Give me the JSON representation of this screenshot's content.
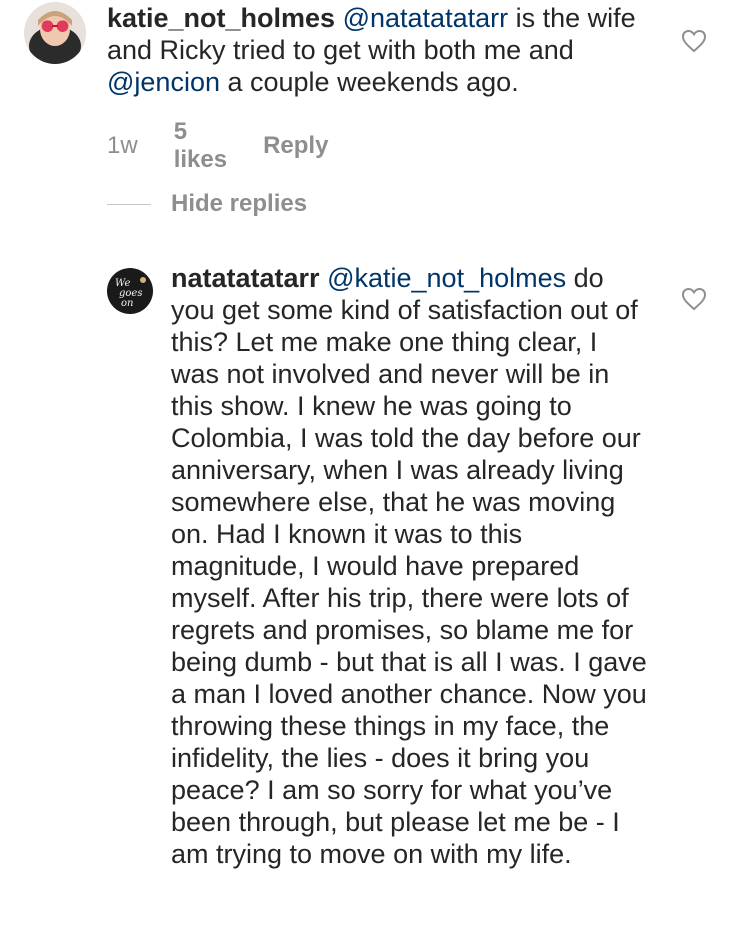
{
  "comment1": {
    "username": "katie_not_holmes",
    "mention1": "@natatatatarr",
    "text_a": " is the wife and Ricky tried to get with both me and ",
    "mention2": "@jencion",
    "text_b": " a couple weekends ago.",
    "time": "1w",
    "likes": "5 likes",
    "reply": "Reply"
  },
  "replies": {
    "hide_label": "Hide replies"
  },
  "comment2": {
    "username": "natatatatarr",
    "mention": "@katie_not_holmes",
    "text": " do you get some kind of satisfaction out of this? Let me make one thing clear, I was not involved and never will be in this show. I knew he was going to Colombia, I was told the day before our anniversary, when I was already living somewhere else, that he was moving on. Had I known it was to this magnitude, I would have prepared myself. After his trip, there were lots of regrets and promises, so blame me for being dumb - but that is all I was. I gave a man I loved another chance. Now you throwing these things in my face, the infidelity, the lies - does it bring you peace? I am so sorry for what you’ve been through, but please let me be - I am trying to move on with my life."
  },
  "colors": {
    "text": "#262626",
    "mention": "#003569",
    "meta": "#8e8e8e"
  },
  "icons": {
    "like": "heart-outline-icon"
  }
}
